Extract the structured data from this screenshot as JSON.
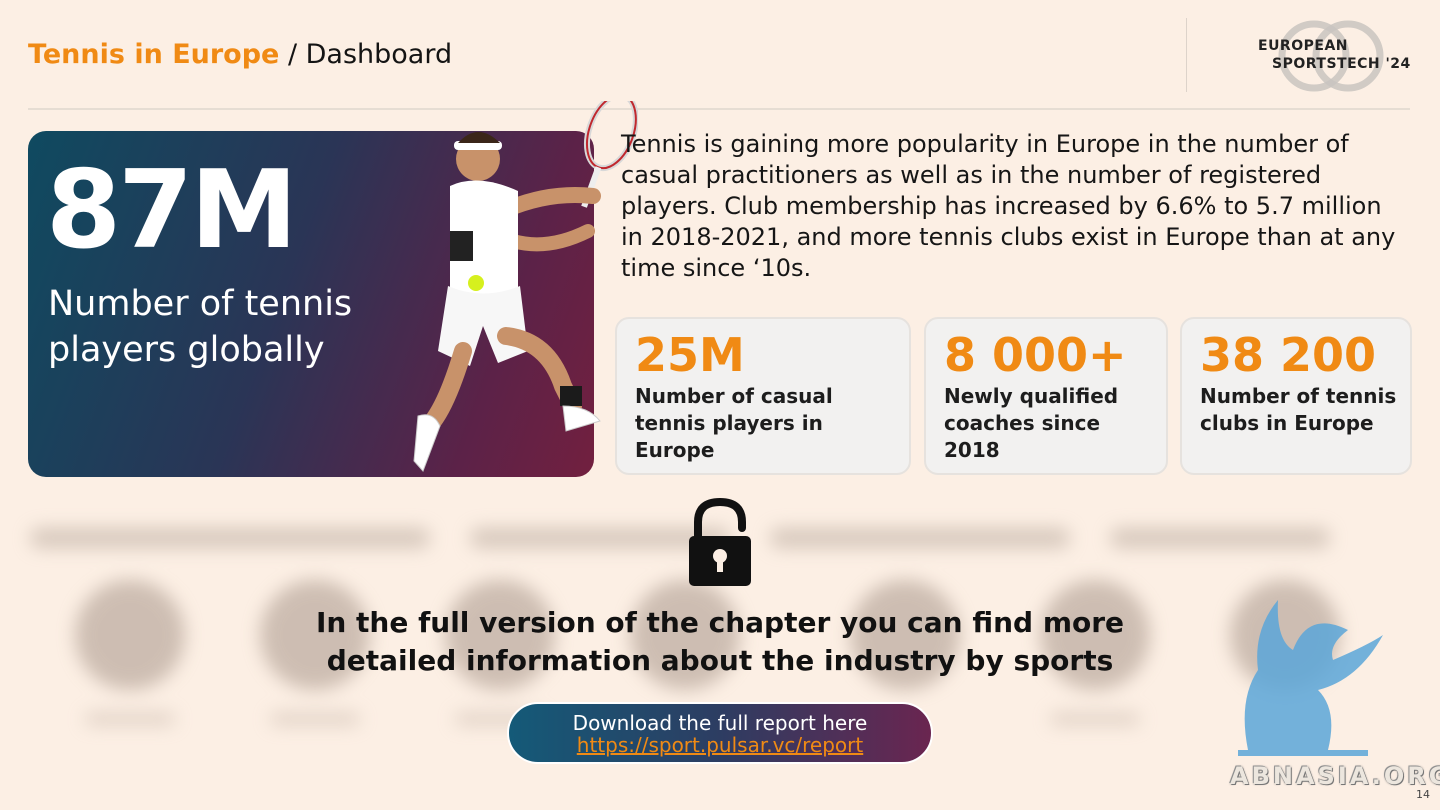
{
  "header": {
    "title_accent": "Tennis in Europe",
    "title_rest": " / Dashboard"
  },
  "logo": {
    "line1": "EUROPEAN",
    "line2": "SPORTSTECH '24"
  },
  "hero": {
    "value": "87M",
    "label": "Number of tennis players globally"
  },
  "intro": "Tennis is gaining more popularity in Europe in the number of casual practitioners as well as in the number of registered players. Club membership has increased by 6.6% to 5.7 million in 2018-2021, and more tennis clubs exist in Europe than at any time since ‘10s.",
  "stats": [
    {
      "value": "25M",
      "label": "Number of casual tennis players in Europe"
    },
    {
      "value": "8 000+",
      "label": "Newly qualified coaches since 2018"
    },
    {
      "value": "38 200",
      "label": "Number of tennis clubs in Europe"
    }
  ],
  "locked": {
    "message_line1": "In the full version of the chapter you can find more",
    "message_line2": "detailed information about the industry by sports"
  },
  "cta": {
    "line1": "Download the full report here",
    "link": "https://sport.pulsar.vc/report"
  },
  "watermark": "ABNASIA.ORG",
  "page_number": "14",
  "colors": {
    "accent": "#f08a14",
    "background": "#fcefe4",
    "card": "#f2f1f0"
  },
  "icons": {
    "lock": "open-padlock-icon",
    "logo": "overlapping-circles-logo"
  }
}
